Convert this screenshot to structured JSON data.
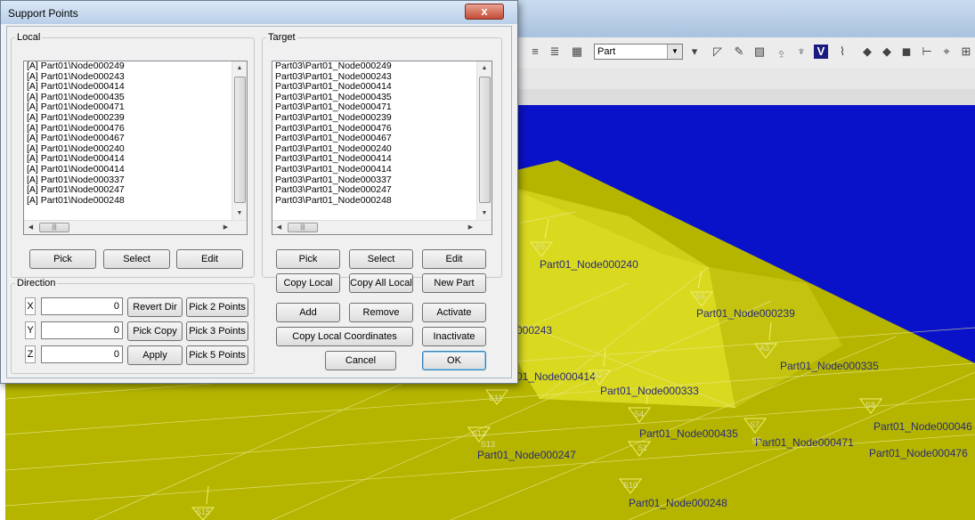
{
  "dialog": {
    "title": "Support Points",
    "close_label": "x",
    "local": {
      "legend": "Local",
      "items": [
        "[A] Part01\\Node000249",
        "[A] Part01\\Node000243",
        "[A] Part01\\Node000414",
        "[A] Part01\\Node000435",
        "[A] Part01\\Node000471",
        "[A] Part01\\Node000239",
        "[A] Part01\\Node000476",
        "[A] Part01\\Node000467",
        "[A] Part01\\Node000240",
        "[A] Part01\\Node000414",
        "[A] Part01\\Node000414",
        "[A] Part01\\Node000337",
        "[A] Part01\\Node000247",
        "[A] Part01\\Node000248"
      ],
      "pick_label": "Pick",
      "select_label": "Select",
      "edit_label": "Edit"
    },
    "target": {
      "legend": "Target",
      "items": [
        "Part03\\Part01_Node000249",
        "Part03\\Part01_Node000243",
        "Part03\\Part01_Node000414",
        "Part03\\Part01_Node000435",
        "Part03\\Part01_Node000471",
        "Part03\\Part01_Node000239",
        "Part03\\Part01_Node000476",
        "Part03\\Part01_Node000467",
        "Part03\\Part01_Node000240",
        "Part03\\Part01_Node000414",
        "Part03\\Part01_Node000414",
        "Part03\\Part01_Node000337",
        "Part03\\Part01_Node000247",
        "Part03\\Part01_Node000248"
      ],
      "pick_label": "Pick",
      "select_label": "Select",
      "edit_label": "Edit",
      "copy_local_label": "Copy Local",
      "copy_all_local_label": "Copy All Local",
      "new_part_label": "New Part"
    },
    "direction": {
      "legend": "Direction",
      "x_label": "X",
      "y_label": "Y",
      "z_label": "Z",
      "x_value": "0",
      "y_value": "0",
      "z_value": "0",
      "revert_dir_label": "Revert Dir",
      "pick_copy_label": "Pick Copy",
      "apply_label": "Apply",
      "pick2_label": "Pick 2 Points",
      "pick3_label": "Pick 3 Points",
      "pick5_label": "Pick 5 Points"
    },
    "actions": {
      "add_label": "Add",
      "remove_label": "Remove",
      "activate_label": "Activate",
      "copy_local_coords_label": "Copy Local Coordinates",
      "inactivate_label": "Inactivate",
      "cancel_label": "Cancel",
      "ok_label": "OK"
    }
  },
  "toolbar": {
    "part_select_value": "Part"
  },
  "viewport": {
    "node_labels": [
      "Part01_Node000240",
      "Part01_Node000239",
      "000243",
      "Part01_Node000335",
      "01_Node000414",
      "Part01_Node000333",
      "Part01_Node000435",
      "Part01_Node000471",
      "Part01_Node000046",
      "Part01_Node000476",
      "Part01_Node000247",
      "Part01_Node000248"
    ],
    "support_labels": [
      "S9",
      "S6",
      "A3",
      "A2",
      "S11",
      "S4",
      "S8",
      "S7",
      "S5",
      "S12",
      "S13",
      "S1",
      "S10",
      "S15"
    ]
  },
  "colors": {
    "viewport_blue": "#0a12c9",
    "part_yellow": "#b8b800",
    "highlight_yellow": "#e0e000"
  }
}
